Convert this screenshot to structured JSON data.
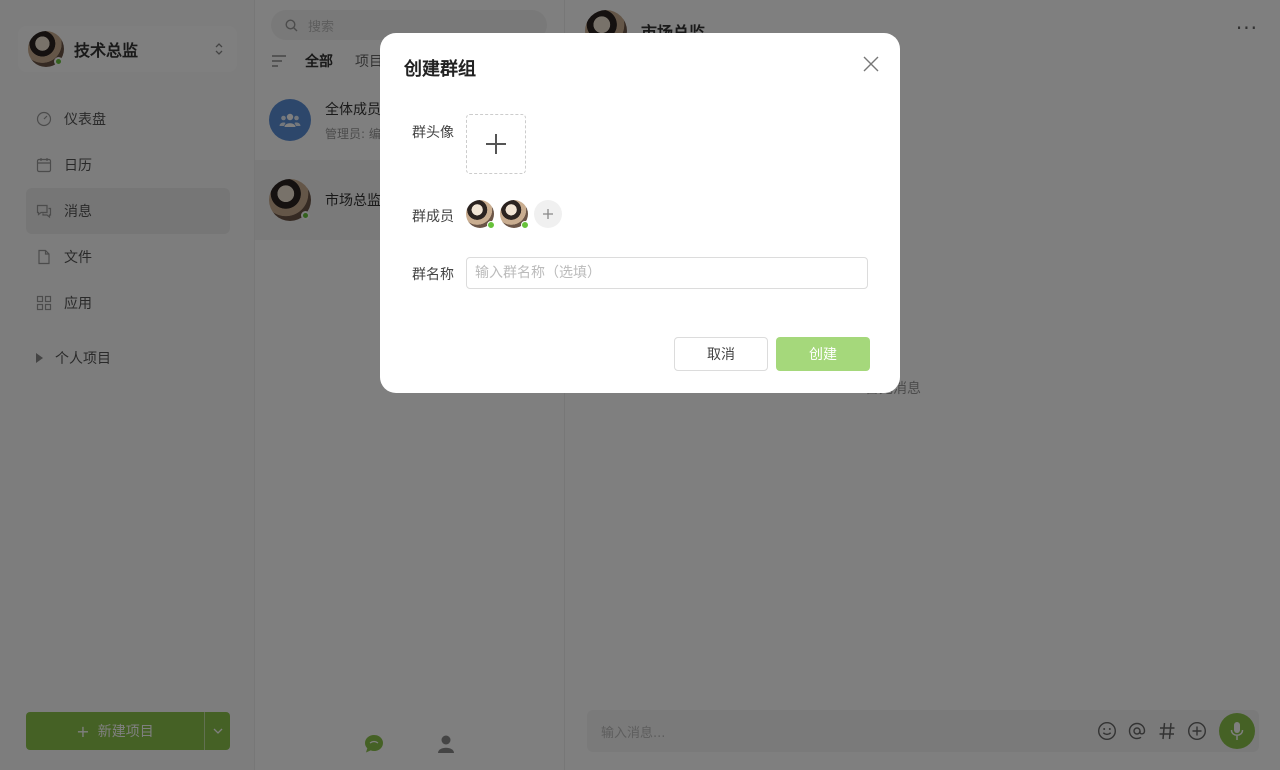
{
  "workspace": {
    "name": "技术总监"
  },
  "nav": {
    "items": [
      {
        "label": "仪表盘",
        "icon": "dashboard-icon"
      },
      {
        "label": "日历",
        "icon": "calendar-icon"
      },
      {
        "label": "消息",
        "icon": "message-icon",
        "active": true
      },
      {
        "label": "文件",
        "icon": "file-icon"
      },
      {
        "label": "应用",
        "icon": "apps-icon"
      }
    ],
    "personal_projects": "个人项目",
    "new_project": "新建项目"
  },
  "conversations": {
    "search_placeholder": "搜索",
    "tabs": [
      "全部",
      "项目"
    ],
    "items": [
      {
        "title": "全体成员",
        "subtitle": "管理员: 编"
      },
      {
        "title": "市场总监",
        "subtitle": ""
      }
    ]
  },
  "chat": {
    "title": "市场总监",
    "empty_text": "暂无消息",
    "input_placeholder": "输入消息..."
  },
  "modal": {
    "title": "创建群组",
    "avatar_label": "群头像",
    "members_label": "群成员",
    "name_label": "群名称",
    "name_placeholder": "输入群名称（选填）",
    "cancel": "取消",
    "create": "创建"
  },
  "colors": {
    "accent": "#8bc34a",
    "online": "#67c23a",
    "group_avatar": "#5b8ed6"
  }
}
